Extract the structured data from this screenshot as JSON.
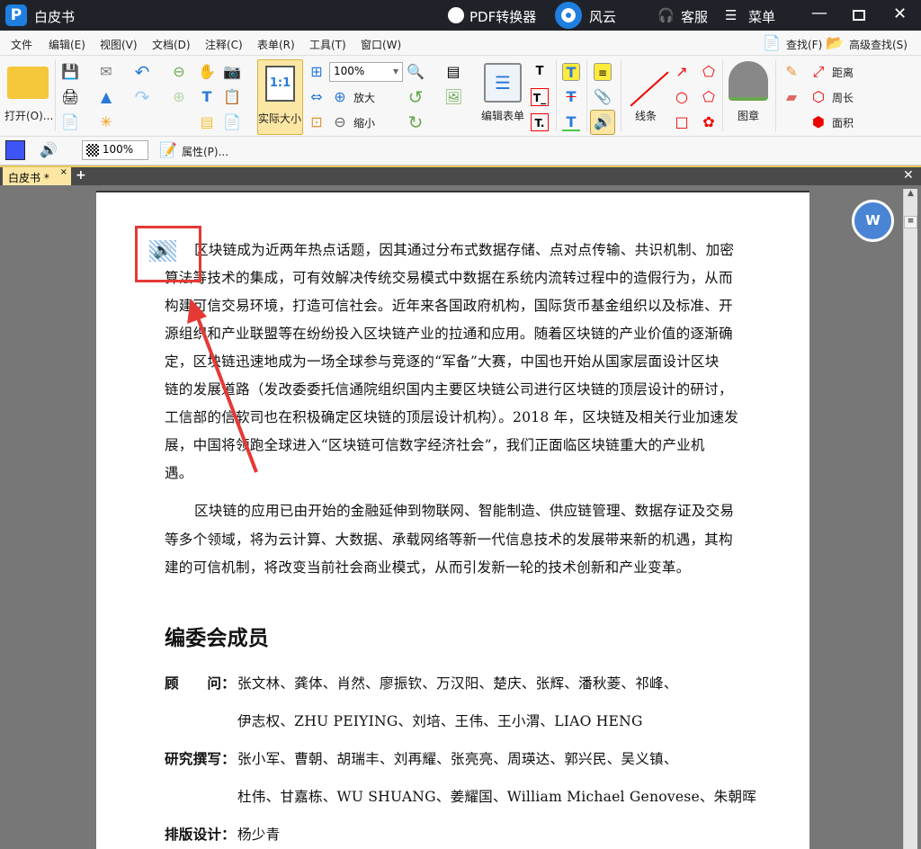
{
  "titlebar": {
    "app_title": "白皮书",
    "converter": "PDF转换器",
    "fengyun": "风云",
    "service": "客服",
    "menu": "菜单"
  },
  "menubar": {
    "items": [
      "文件",
      "编辑(E)",
      "视图(V)",
      "文档(D)",
      "注释(C)",
      "表单(R)",
      "工具(T)",
      "窗口(W)"
    ],
    "find": "查找(F)",
    "advanced_find": "高级查找(S)"
  },
  "toolbar": {
    "open": "打开(O)...",
    "actual_size": "实际大小",
    "zoom_value": "100%",
    "zoom_in": "放大",
    "zoom_out": "缩小",
    "edit_form": "编辑表单",
    "lines": "线条",
    "stamp": "图章",
    "distance": "距离",
    "perimeter": "周长",
    "area": "面积"
  },
  "toolbar2": {
    "opacity": "100%",
    "properties": "属性(P)..."
  },
  "tabs": [
    {
      "label": "白皮书 *"
    }
  ],
  "document": {
    "para1": [
      "区块链成为近两年热点话题，因其通过分布式数据存储、点对点传输、共识机制、加密",
      "算法等技术的集成，可有效解决传统交易模式中数据在系统内流转过程中的造假行为，从而",
      "构建可信交易环境，打造可信社会。近年来各国政府机构，国际货币基金组织以及标准、开",
      "源组织和产业联盟等在纷纷投入区块链产业的拉通和应用。随着区块链的产业价值的逐渐确",
      "定，区块链迅速地成为一场全球参与竞逐的“军备”大赛，中国也开始从国家层面设计区块",
      "链的发展道路（发改委委托信通院组织国内主要区块链公司进行区块链的顶层设计的研讨，",
      "工信部的信软司也在积极确定区块链的顶层设计机构）。2018 年，区块链及相关行业加速发",
      "展，中国将领跑全球进入“区块链可信数字经济社会”，我们正面临区块链重大的产业机",
      "遇。"
    ],
    "para2": [
      "区块链的应用已由开始的金融延伸到物联网、智能制造、供应链管理、数据存证及交易",
      "等多个领域，将为云计算、大数据、承载网络等新一代信息技术的发展带来新的机遇，其构",
      "建的可信机制，将改变当前社会商业模式，从而引发新一轮的技术创新和产业变革。"
    ],
    "heading": "编委会成员",
    "members": [
      {
        "role": "顾　　问：",
        "lines": [
          "张文林、龚体、肖然、廖振钦、万汉阳、楚庆、张辉、潘秋菱、祁峰、",
          "伊志权、ZHU PEIYING、刘培、王伟、王小渭、LIAO HENG"
        ]
      },
      {
        "role": "研究撰写：",
        "lines": [
          "张小军、曹朝、胡瑞丰、刘再耀、张亮亮、周瑛达、郭兴民、吴义镇、",
          "杜伟、甘嘉栋、WU SHUANG、姜耀国、William Michael Genovese、朱朝晖"
        ]
      },
      {
        "role": "排版设计：",
        "lines": [
          "杨少青"
        ]
      }
    ]
  },
  "colors": {
    "titlebar": "#1f2329",
    "accent": "#1e7fe0",
    "highlight": "#e53935"
  }
}
